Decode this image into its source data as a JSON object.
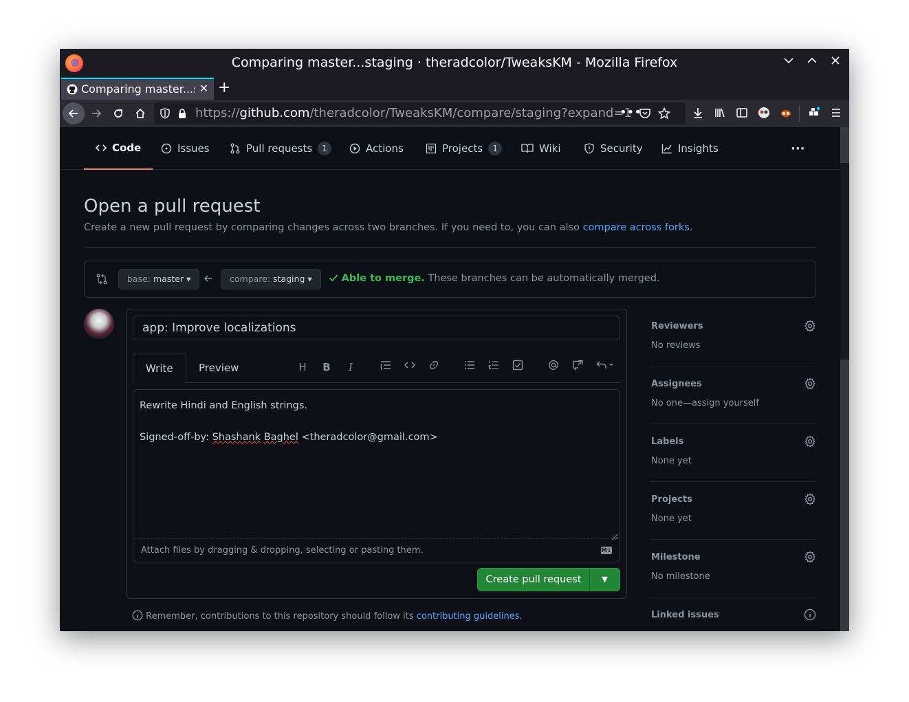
{
  "window": {
    "title": "Comparing master...staging · theradcolor/TweaksKM - Mozilla Firefox"
  },
  "tabs": [
    {
      "label": "Comparing master...staging · theradcolor/TweaksKM"
    }
  ],
  "navbar": {
    "url_scheme": "https://",
    "url_host": "github.com",
    "url_path": "/theradcolor/TweaksKM/compare/staging?expand=1"
  },
  "repo_nav": {
    "items": [
      {
        "label": "Code",
        "icon": "code-icon"
      },
      {
        "label": "Issues",
        "icon": "issue-icon"
      },
      {
        "label": "Pull requests",
        "icon": "pull-request-icon",
        "count": "1"
      },
      {
        "label": "Actions",
        "icon": "play-icon"
      },
      {
        "label": "Projects",
        "icon": "project-icon",
        "count": "1"
      },
      {
        "label": "Wiki",
        "icon": "book-icon"
      },
      {
        "label": "Security",
        "icon": "shield-icon"
      },
      {
        "label": "Insights",
        "icon": "graph-icon"
      }
    ]
  },
  "page": {
    "title": "Open a pull request",
    "desc_prefix": "Create a new pull request by comparing changes across two branches. If you need to, you can also ",
    "desc_link": "compare across forks",
    "desc_suffix": "."
  },
  "range": {
    "base_label": "base:",
    "base_value": "master",
    "compare_label": "compare:",
    "compare_value": "staging",
    "merge_ok": "Able to merge.",
    "merge_text": "These branches can be automatically merged."
  },
  "composer": {
    "title_value": "app: Improve localizations",
    "write_tab": "Write",
    "preview_tab": "Preview",
    "body_line1": "Rewrite Hindi and English strings.",
    "body_signed_prefix": "Signed-off-by: ",
    "body_name_first": "Shashank",
    "body_name_last": "Baghel",
    "body_email": " <theradcolor@gmail.com>",
    "attach_text": "Attach files by dragging & dropping, selecting or pasting them.",
    "create_button": "Create pull request"
  },
  "remember": {
    "prefix": "Remember, contributions to this repository should follow its ",
    "link": "contributing guidelines",
    "suffix": "."
  },
  "sidebar": {
    "sections": [
      {
        "heading": "Reviewers",
        "value": "No reviews"
      },
      {
        "heading": "Assignees",
        "value": "No one—assign yourself"
      },
      {
        "heading": "Labels",
        "value": "None yet"
      },
      {
        "heading": "Projects",
        "value": "None yet"
      },
      {
        "heading": "Milestone",
        "value": "No milestone"
      },
      {
        "heading": "Linked issues",
        "value": ""
      }
    ]
  },
  "colors": {
    "accent_link": "#58a6ff",
    "success": "#3fb950",
    "primary_button": "#238636",
    "active_tab_underline": "#f78166"
  }
}
